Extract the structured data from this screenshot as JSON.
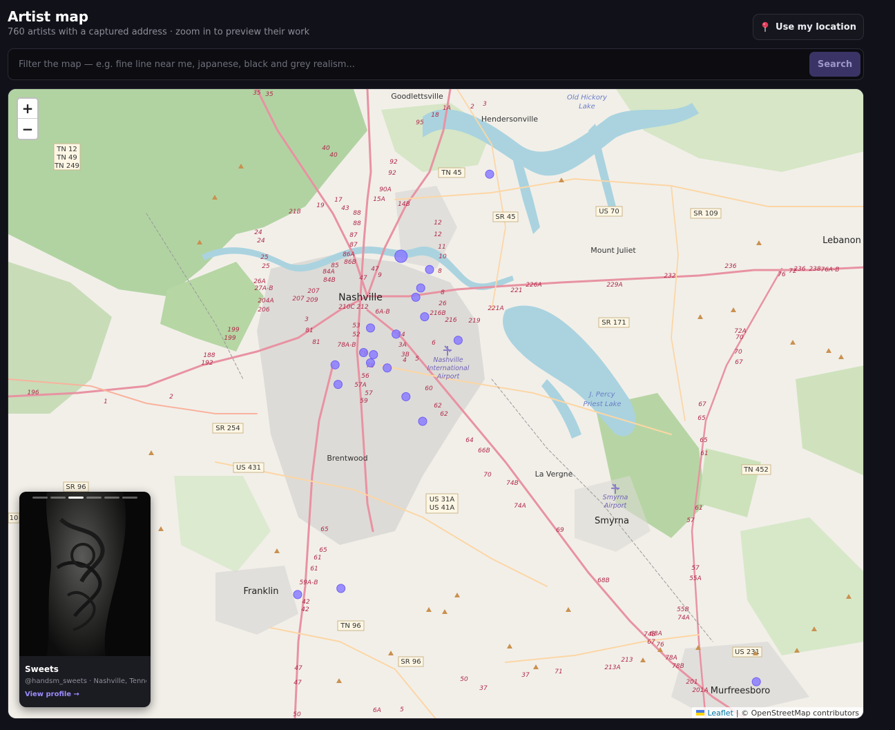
{
  "header": {
    "title": "Artist map",
    "subtitle": "760 artists with a captured address · zoom in to preview their work",
    "location_button": "Use my location",
    "location_icon": "map-pin-icon"
  },
  "search": {
    "placeholder": "Filter the map — e.g. fine line near me, japanese, black and grey realism...",
    "value": "",
    "button_label": "Search"
  },
  "map": {
    "zoom_in": "+",
    "zoom_out": "−",
    "attribution_leaflet": "Leaflet",
    "attribution_rest": "| © OpenStreetMap contributors",
    "labels": {
      "nashville": "Nashville",
      "goodlettsville": "Goodlettsville",
      "hendersonville": "Hendersonville",
      "old_hickory": "Old Hickory",
      "old_hickory_2": "Lake",
      "mount_juliet": "Mount Juliet",
      "lebanon": "Lebanon",
      "brentwood": "Brentwood",
      "franklin": "Franklin",
      "la_vergne": "La Vergne",
      "smyrna": "Smyrna",
      "murfreesboro": "Murfreesboro",
      "airport_1": "Nashville",
      "airport_2": "International",
      "airport_3": "Airport",
      "smyrna_airport_1": "Smyrna",
      "smyrna_airport_2": "Airport",
      "percy_1": "J. Percy",
      "percy_2": "Priest Lake"
    },
    "shields": {
      "tn12": "TN 12",
      "tn49": "TN 49",
      "tn249": "TN 249",
      "tn45": "TN 45",
      "us70": "US 70",
      "sr109": "SR 109",
      "sr45": "SR 45",
      "sr171": "SR 171",
      "sr254": "SR 254",
      "us431": "US 431",
      "sr96a": "SR 96",
      "us31a": "US 31A",
      "us41a": "US 41A",
      "tn452": "TN 452",
      "tn96": "TN 96",
      "sr96b": "SR 96",
      "us231": "US 231",
      "ten": "10"
    },
    "exits": [
      "35",
      "35",
      "18",
      "1A",
      "2",
      "3",
      "95",
      "40",
      "40",
      "92",
      "92",
      "90A",
      "17",
      "15A",
      "14B",
      "21B",
      "19",
      "88",
      "43",
      "12",
      "12",
      "88",
      "87",
      "87",
      "24",
      "24",
      "25",
      "25",
      "86A",
      "86B",
      "85",
      "84A",
      "84B",
      "11",
      "10",
      "47",
      "47",
      "9",
      "8",
      "8",
      "26",
      "26A",
      "27A-B",
      "204A",
      "206",
      "207",
      "207",
      "209",
      "210C",
      "212",
      "6A-B",
      "216B",
      "216",
      "219",
      "221A",
      "221",
      "226A",
      "229A",
      "232",
      "236",
      "236",
      "238",
      "76A-B",
      "76",
      "72",
      "72A",
      "70",
      "70",
      "67",
      "67",
      "65",
      "65",
      "61",
      "61",
      "57",
      "57",
      "55A",
      "55B",
      "74A",
      "74B",
      "76",
      "78A",
      "78B",
      "201",
      "201A",
      "199",
      "199",
      "188",
      "192",
      "196",
      "1",
      "2",
      "3",
      "81",
      "81",
      "53",
      "52",
      "54",
      "3A",
      "3B",
      "4",
      "5",
      "6",
      "78A-B",
      "79",
      "78",
      "56",
      "57A",
      "57",
      "59",
      "60",
      "62",
      "62",
      "64",
      "66B",
      "70",
      "74B",
      "74A",
      "69",
      "68B",
      "68A",
      "67",
      "65",
      "65",
      "61",
      "61",
      "59A-B",
      "42",
      "42",
      "47",
      "47",
      "50",
      "50",
      "37",
      "37",
      "71",
      "213A",
      "213",
      "6A",
      "5"
    ],
    "markers": [
      {
        "lat": 36.262,
        "lng": -86.756
      },
      {
        "lat": 36.342,
        "lng": -86.666
      },
      {
        "lat": 36.249,
        "lng": -86.727
      },
      {
        "lat": 36.231,
        "lng": -86.736
      },
      {
        "lat": 36.222,
        "lng": -86.741
      },
      {
        "lat": 36.203,
        "lng": -86.732
      },
      {
        "lat": 36.192,
        "lng": -86.787
      },
      {
        "lat": 36.186,
        "lng": -86.761
      },
      {
        "lat": 36.18,
        "lng": -86.698
      },
      {
        "lat": 36.168,
        "lng": -86.794
      },
      {
        "lat": 36.166,
        "lng": -86.784
      },
      {
        "lat": 36.158,
        "lng": -86.787
      },
      {
        "lat": 36.156,
        "lng": -86.823
      },
      {
        "lat": 36.153,
        "lng": -86.77
      },
      {
        "lat": 36.137,
        "lng": -86.82
      },
      {
        "lat": 36.125,
        "lng": -86.751
      },
      {
        "lat": 36.101,
        "lng": -86.734
      },
      {
        "lat": 35.932,
        "lng": -86.861
      },
      {
        "lat": 35.938,
        "lng": -86.817
      },
      {
        "lat": 35.847,
        "lng": -86.395
      }
    ]
  },
  "preview_card": {
    "name": "Sweets",
    "meta": "@handsm_sweets · Nashville, Tennessee",
    "link": "View profile →",
    "slides_total": 6,
    "slide_active": 3
  }
}
